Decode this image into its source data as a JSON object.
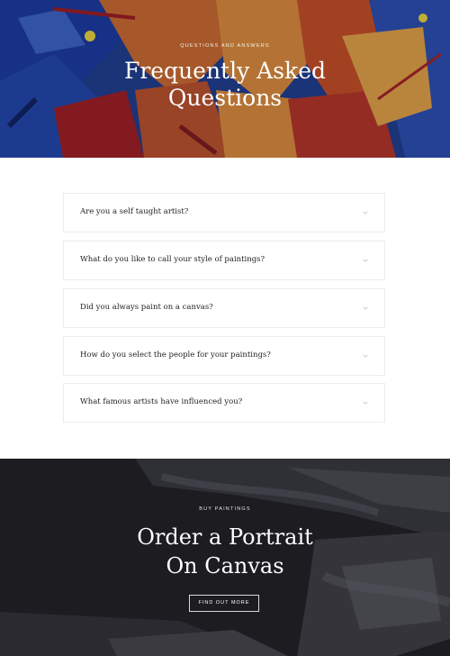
{
  "hero": {
    "eyebrow": "QUESTIONS AND ANSWERS",
    "title_line1": "Frequently Asked",
    "title_line2": "Questions"
  },
  "faq": {
    "items": [
      {
        "question": "Are you a self taught artist?",
        "icon": "chevron-down-icon"
      },
      {
        "question": "What do you like to call your style of paintings?",
        "icon": "chevron-down-icon"
      },
      {
        "question": "Did you always paint on a canvas?",
        "icon": "chevron-down-icon"
      },
      {
        "question": "How do you select the people for your paintings?",
        "icon": "chevron-down-icon"
      },
      {
        "question": "What famous artists have influenced you?",
        "icon": "chevron-down-icon"
      }
    ]
  },
  "cta": {
    "eyebrow": "BUY PAINTINGS",
    "title_line1": "Order a Portrait",
    "title_line2": "On Canvas",
    "button_label": "FIND OUT MORE"
  },
  "colors": {
    "hero_blue": "#1d3a8a",
    "hero_orange": "#c8682f",
    "hero_red": "#a71f24",
    "cta_dark": "#1c1c21",
    "border": "#ececec"
  }
}
